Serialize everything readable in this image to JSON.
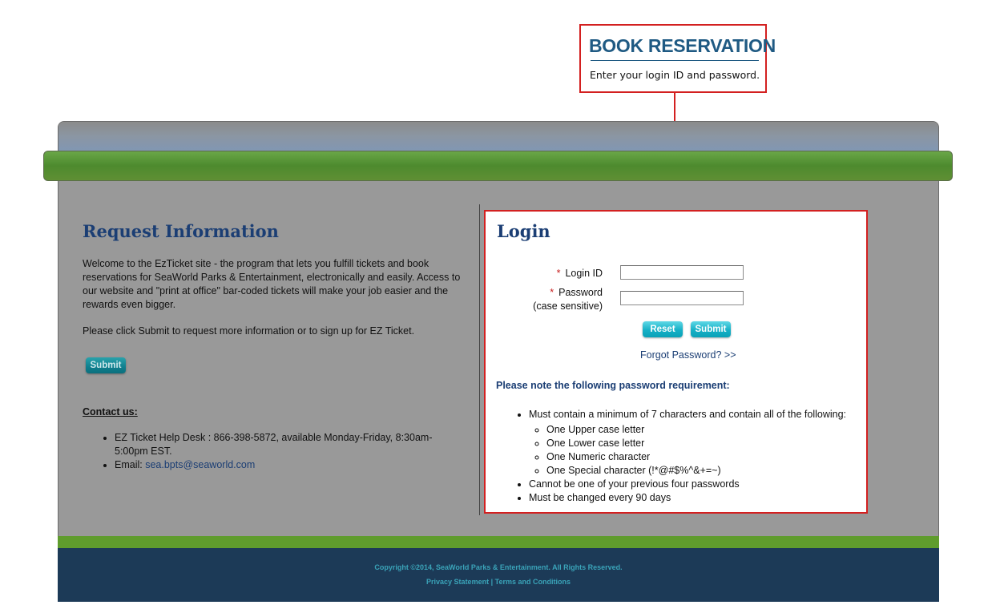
{
  "callout": {
    "title": "BOOK RESERVATION",
    "text": "Enter your login ID and password."
  },
  "left": {
    "heading": "Request Information",
    "paragraph1": "Welcome to the EzTicket site - the program that lets you fulfill tickets and book reservations for SeaWorld Parks & Entertainment, electronically and easily. Access to our website and \"print at office\" bar-coded tickets will make your job easier and the rewards even bigger.",
    "paragraph2": "Please click Submit to request more information or to sign up for EZ Ticket.",
    "submit_label": "Submit",
    "contact_heading": "Contact us:",
    "contact_items": [
      "EZ Ticket Help Desk : 866-398-5872, available Monday-Friday, 8:30am-5:00pm EST.",
      "Email: "
    ],
    "email": "sea.bpts@seaworld.com"
  },
  "login": {
    "heading": "Login",
    "required_mark": "*",
    "login_id_label": "Login ID",
    "password_label": "Password",
    "password_hint": "(case sensitive)",
    "login_id_value": "",
    "password_value": "",
    "reset_label": "Reset",
    "submit_label": "Submit",
    "forgot_label": "Forgot Password? >>",
    "note": "Please note the following password requirement:",
    "requirements": {
      "main": "Must contain a minimum of 7 characters and contain all of the following:",
      "sub": [
        "One Upper case letter",
        "One Lower case letter",
        "One Numeric character",
        "One Special character (!*@#$%^&+=~)"
      ],
      "other": [
        "Cannot be one of your previous four passwords",
        "Must be changed every 90 days"
      ]
    }
  },
  "footer": {
    "copyright": "Copyright ©2014, SeaWorld Parks & Entertainment. All Rights Reserved.",
    "privacy": "Privacy Statement",
    "separator": " | ",
    "terms": "Terms and Conditions"
  },
  "colors": {
    "accent": "#d32020",
    "heading": "#1b3e74",
    "button": "#16b0c6",
    "green_bar": "#4d8a2e",
    "footer_bg": "#1c3a57"
  }
}
